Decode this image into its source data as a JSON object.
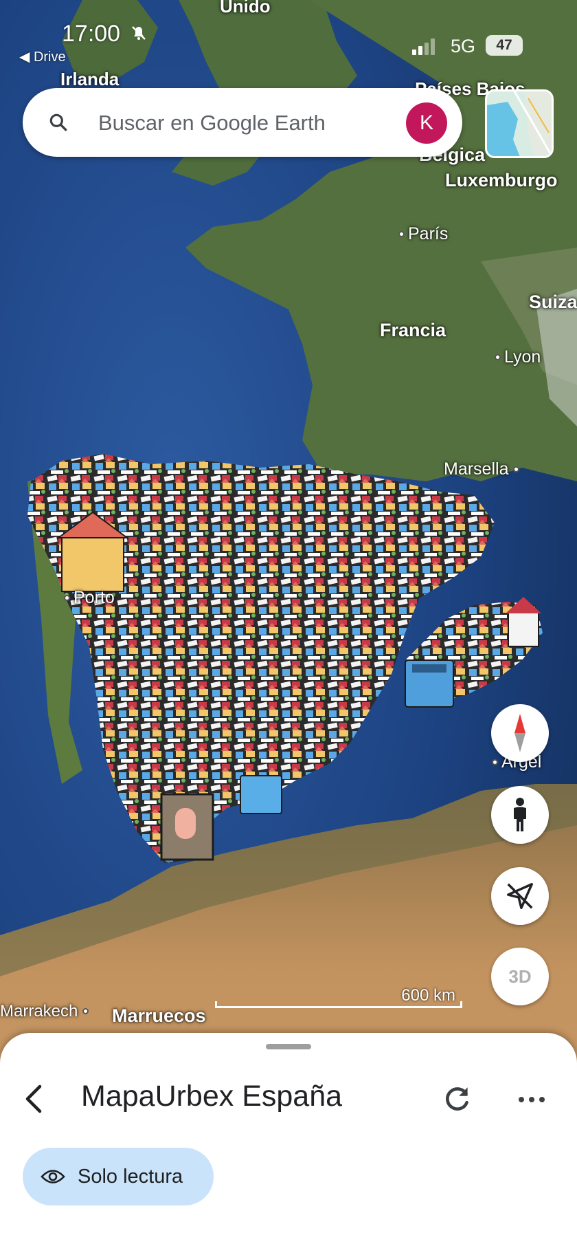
{
  "status_bar": {
    "time": "17:00",
    "back_app": "Drive",
    "network": "5G",
    "battery": "47"
  },
  "search": {
    "placeholder": "Buscar en Google Earth",
    "avatar_initial": "K",
    "avatar_color": "#c2185b"
  },
  "map": {
    "labels": {
      "unido": "Unido",
      "irlanda": "Irlanda",
      "paises_bajos": "Países Bajos",
      "belgica": "Bélgica",
      "luxemburgo": "Luxemburgo",
      "paris": "París",
      "suiza": "Suiza",
      "francia": "Francia",
      "lyon": "Lyon",
      "marsella": "Marsella",
      "porto": "Porto",
      "argel": "Argel",
      "marrakech": "Marrakech",
      "marruecos": "Marruecos"
    },
    "scale_text": "600 km"
  },
  "controls": {
    "compass_icon": "compass-icon",
    "street_view_icon": "pegman-icon",
    "location_icon": "location-off-icon",
    "three_d_label": "3D"
  },
  "sheet": {
    "title": "MapaUrbex España",
    "chip_label": "Solo lectura"
  },
  "colors": {
    "ocean": "#1d4382",
    "land": "#4f6a3f",
    "desert": "#b8885a",
    "chip_bg": "#c9e3fb"
  }
}
